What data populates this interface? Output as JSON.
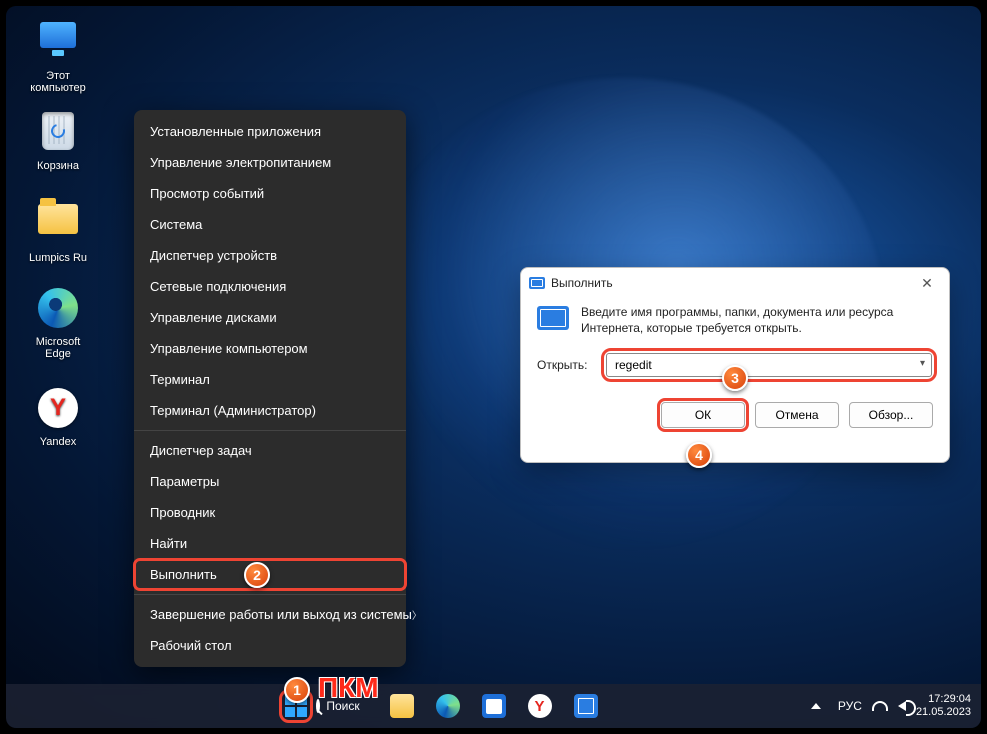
{
  "desktop_icons": [
    {
      "label": "Этот компьютер"
    },
    {
      "label": "Корзина"
    },
    {
      "label": "Lumpics Ru"
    },
    {
      "label": "Microsoft Edge"
    },
    {
      "label": "Yandex"
    }
  ],
  "winx_menu": {
    "groups": [
      [
        "Установленные приложения",
        "Управление электропитанием",
        "Просмотр событий",
        "Система",
        "Диспетчер устройств",
        "Сетевые подключения",
        "Управление дисками",
        "Управление компьютером",
        "Терминал",
        "Терминал (Администратор)"
      ],
      [
        "Диспетчер задач",
        "Параметры",
        "Проводник",
        "Найти",
        "Выполнить"
      ],
      [
        {
          "label": "Завершение работы или выход из системы",
          "submenu": true
        },
        {
          "label": "Рабочий стол"
        }
      ]
    ],
    "highlighted": "Выполнить"
  },
  "run_dialog": {
    "title": "Выполнить",
    "prompt": "Введите имя программы, папки, документа или ресурса Интернета, которые требуется открыть.",
    "open_label": "Открыть:",
    "value": "regedit",
    "ok": "ОК",
    "cancel": "Отмена",
    "browse": "Обзор..."
  },
  "taskbar": {
    "search_placeholder": "Поиск",
    "lang": "РУС",
    "time": "17:29:04",
    "date": "21.05.2023"
  },
  "annotations": {
    "pkm": "ПКМ",
    "m1": "1",
    "m2": "2",
    "m3": "3",
    "m4": "4"
  }
}
